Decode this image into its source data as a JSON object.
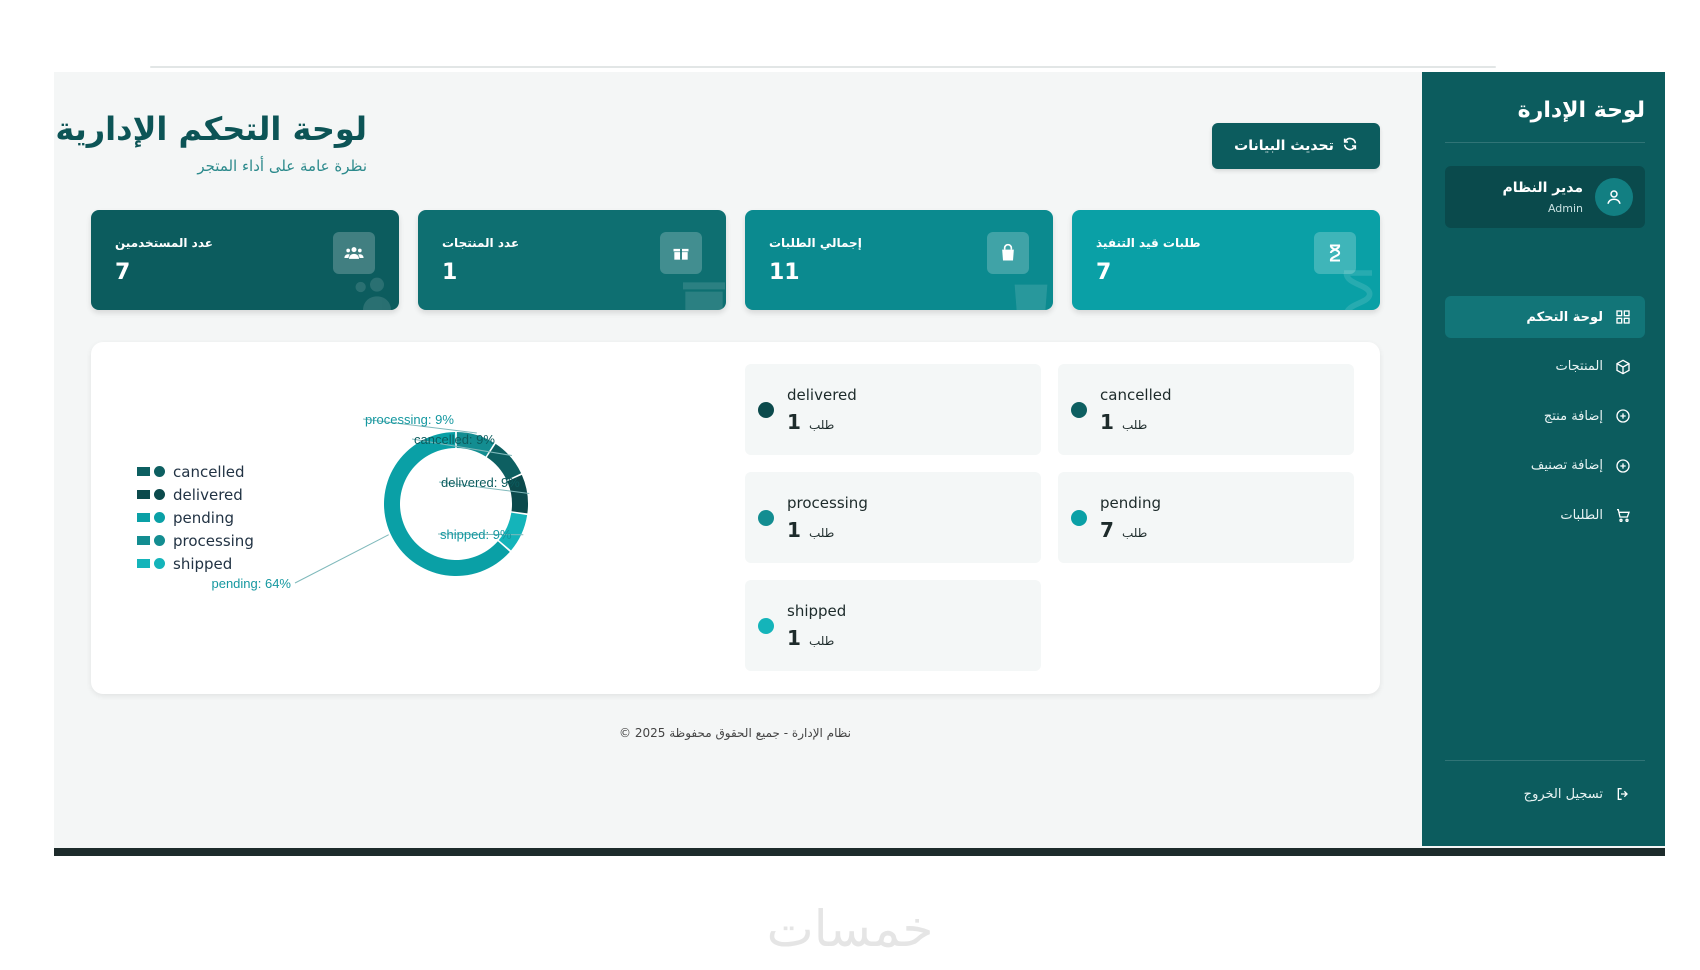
{
  "sidebar": {
    "title": "لوحة الإدارة",
    "user": {
      "name": "مدير النظام",
      "role": "Admin"
    },
    "items": [
      {
        "label": "لوحة التحكم",
        "icon": "grid-icon",
        "active": true
      },
      {
        "label": "المنتجات",
        "icon": "box-icon",
        "active": false
      },
      {
        "label": "إضافة منتج",
        "icon": "plus-circle-icon",
        "active": false
      },
      {
        "label": "إضافة تصنيف",
        "icon": "plus-circle-icon",
        "active": false
      },
      {
        "label": "الطلبات",
        "icon": "cart-icon",
        "active": false
      }
    ],
    "logout_label": "تسجيل الخروج"
  },
  "header": {
    "title": "لوحة التحكم الإدارية",
    "subtitle": "نظرة عامة على أداء المتجر",
    "refresh_label": "تحديث البيانات"
  },
  "stats": [
    {
      "label": "عدد المستخدمين",
      "value": "7",
      "icon": "users-icon",
      "color": "#0c5c5e"
    },
    {
      "label": "عدد المنتجات",
      "value": "1",
      "icon": "box-icon",
      "color": "#0e6f71"
    },
    {
      "label": "إجمالي الطلبات",
      "value": "11",
      "icon": "bag-icon",
      "color": "#0b8a8f"
    },
    {
      "label": "طلبات قيد التنفيذ",
      "value": "7",
      "icon": "hourglass-icon",
      "color": "#0aa0a6"
    }
  ],
  "chart_data": {
    "type": "pie",
    "donut": true,
    "categories": [
      "pending",
      "processing",
      "cancelled",
      "delivered",
      "shipped"
    ],
    "values": [
      7,
      1,
      1,
      1,
      1
    ],
    "slice_labels": [
      "pending: 64%",
      "processing: 9%",
      "cancelled: 9%",
      "delivered: 9%",
      "shipped: 9%"
    ],
    "colors": [
      "#0aa0a6",
      "#138d91",
      "#0d5f61",
      "#0b4a4c",
      "#14b4ba"
    ],
    "legend": [
      "cancelled",
      "delivered",
      "pending",
      "processing",
      "shipped"
    ],
    "legend_colors": [
      "#0d5f61",
      "#0b4a4c",
      "#0aa0a6",
      "#138d91",
      "#14b4ba"
    ],
    "legend_position": "left"
  },
  "status_cards": [
    {
      "name": "cancelled",
      "count": "1",
      "unit": "طلب",
      "color": "#0d5f61"
    },
    {
      "name": "delivered",
      "count": "1",
      "unit": "طلب",
      "color": "#0b4a4c"
    },
    {
      "name": "pending",
      "count": "7",
      "unit": "طلب",
      "color": "#0aa0a6"
    },
    {
      "name": "processing",
      "count": "1",
      "unit": "طلب",
      "color": "#138d91"
    },
    {
      "name": "shipped",
      "count": "1",
      "unit": "طلب",
      "color": "#14b4ba"
    }
  ],
  "footer": "نظام الإدارة - جميع الحقوق محفوظة 2025 ©",
  "watermark": "خمسات"
}
